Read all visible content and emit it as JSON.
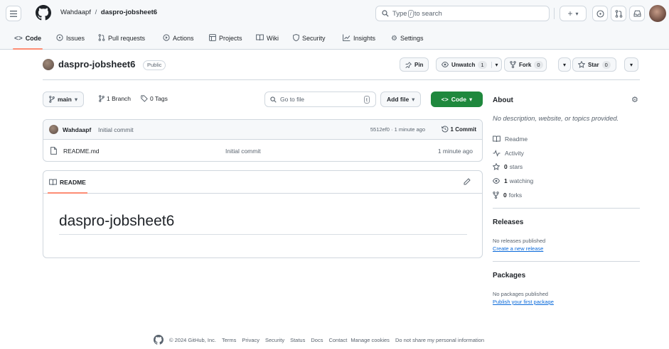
{
  "header": {
    "owner": "Wahdaapf",
    "separator": "/",
    "repo": "daspro-jobsheet6",
    "search_prefix": "Type",
    "search_key": "/",
    "search_suffix": "to search",
    "plus": "+",
    "caret": "▾"
  },
  "tabs": [
    {
      "label": "Code"
    },
    {
      "label": "Issues"
    },
    {
      "label": "Pull requests"
    },
    {
      "label": "Actions"
    },
    {
      "label": "Projects"
    },
    {
      "label": "Wiki"
    },
    {
      "label": "Security"
    },
    {
      "label": "Insights"
    },
    {
      "label": "Settings"
    }
  ],
  "repo_header": {
    "name": "daspro-jobsheet6",
    "visibility": "Public",
    "pin": "Pin",
    "unwatch": "Unwatch",
    "unwatch_count": "1",
    "fork": "Fork",
    "fork_count": "0",
    "star": "Star",
    "star_count": "0"
  },
  "toolbar": {
    "branch": "main",
    "branches": "1 Branch",
    "tags": "0 Tags",
    "goto_placeholder": "Go to file",
    "goto_key": "t",
    "add_file": "Add file",
    "code": "Code"
  },
  "commit": {
    "author": "Wahdaapf",
    "message": "Initial commit",
    "meta": "5512ef0 · 1 minute ago",
    "count": "1 Commit"
  },
  "files": [
    {
      "name": "README.md",
      "message": "Initial commit",
      "time": "1 minute ago"
    }
  ],
  "readme": {
    "tab": "README",
    "title": "daspro-jobsheet6"
  },
  "about": {
    "heading": "About",
    "description": "No description, website, or topics provided.",
    "readme": "Readme",
    "activity": "Activity",
    "stars_n": "0",
    "stars_l": "stars",
    "watching_n": "1",
    "watching_l": "watching",
    "forks_n": "0",
    "forks_l": "forks"
  },
  "releases": {
    "heading": "Releases",
    "text": "No releases published",
    "link": "Create a new release"
  },
  "packages": {
    "heading": "Packages",
    "text": "No packages published",
    "link": "Publish your first package"
  },
  "footer": {
    "copyright": "© 2024 GitHub, Inc.",
    "links": [
      "Terms",
      "Privacy",
      "Security",
      "Status",
      "Docs",
      "Contact",
      "Manage cookies",
      "Do not share my personal information"
    ]
  },
  "colors": {
    "accent": "#1f883d",
    "tab_underline": "#fd8c73",
    "link": "#0969da"
  }
}
